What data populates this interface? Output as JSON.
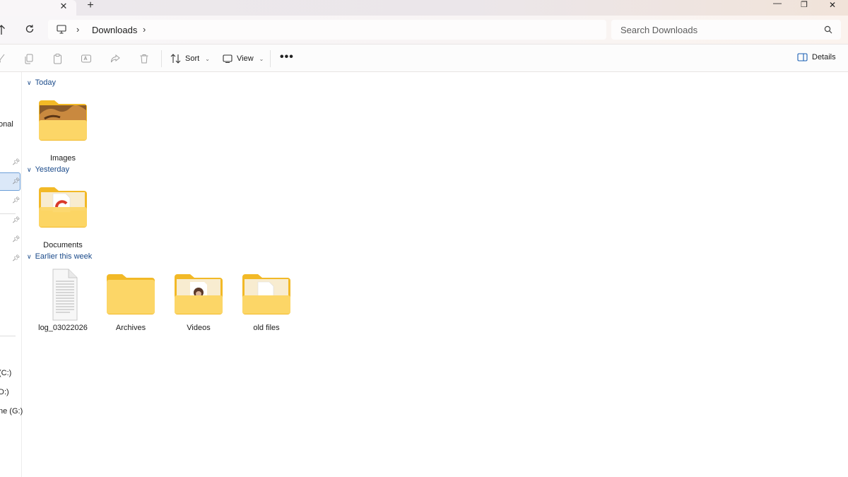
{
  "window": {
    "tab_close_glyph": "✕",
    "new_tab_glyph": "+",
    "minimize_glyph": "—",
    "restore_glyph": "❐",
    "close_glyph": "✕"
  },
  "address_bar": {
    "path": [
      "Downloads"
    ],
    "search_placeholder": "Search Downloads"
  },
  "command_bar": {
    "sort_label": "Sort",
    "view_label": "View",
    "more_label": "•••",
    "details_label": "Details"
  },
  "sidebar": {
    "truncated_labels": [
      "onal",
      "(C:)",
      "D:)",
      "ne (G:)"
    ]
  },
  "groups": [
    {
      "title": "Today",
      "items": [
        {
          "name": "Images",
          "type": "folder-photo"
        }
      ]
    },
    {
      "title": "Yesterday",
      "items": [
        {
          "name": "Documents",
          "type": "folder-doc"
        }
      ]
    },
    {
      "title": "Earlier this week",
      "items": [
        {
          "name": "log_03022026",
          "type": "text-file"
        },
        {
          "name": "Archives",
          "type": "folder"
        },
        {
          "name": "Videos",
          "type": "folder-video"
        },
        {
          "name": "old files",
          "type": "folder-doc-plain"
        }
      ]
    }
  ],
  "colors": {
    "folder_back": "#f2b927",
    "folder_front": "#fcd667",
    "accent_text": "#1a4a8a",
    "selection": "#dbe8f8"
  }
}
